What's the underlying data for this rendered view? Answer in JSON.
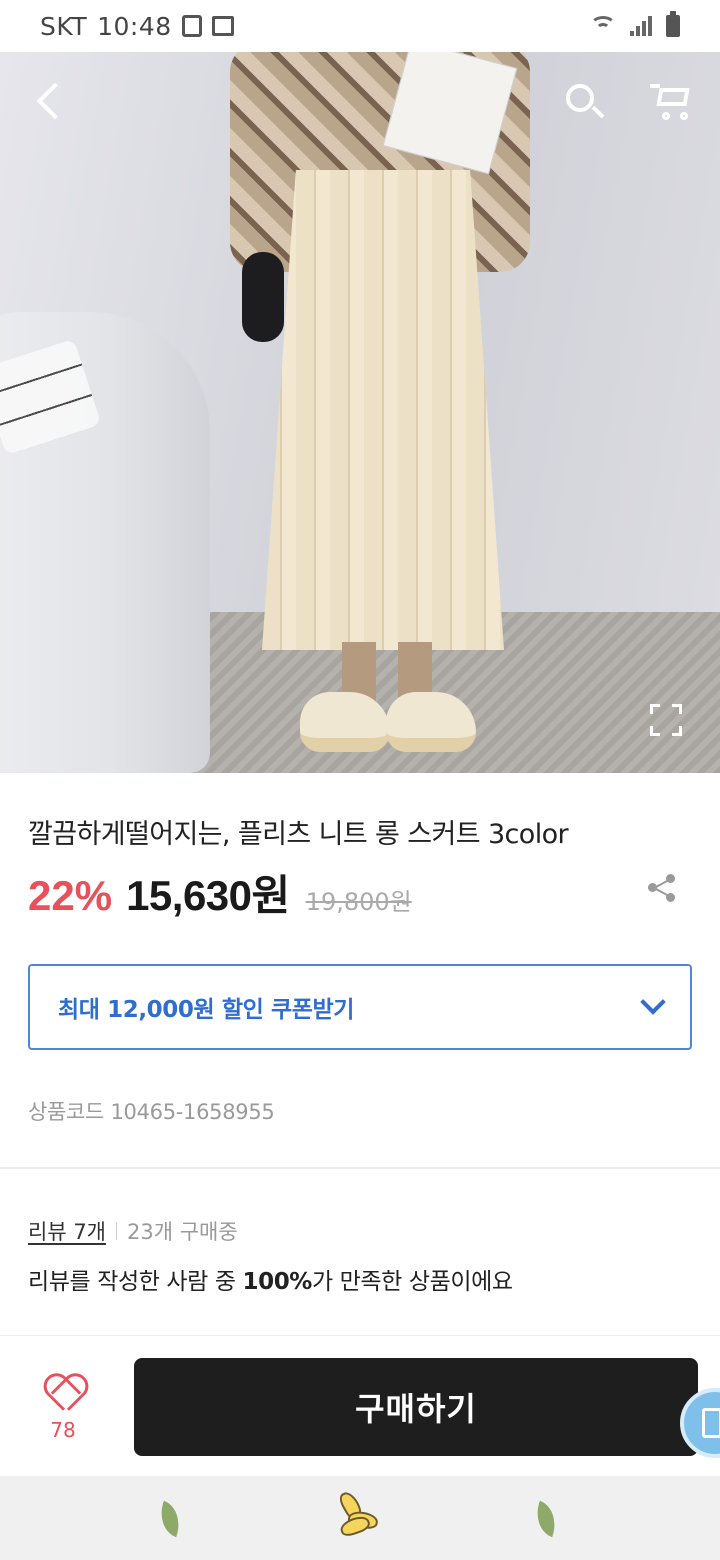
{
  "status_bar": {
    "carrier": "SKT",
    "time": "10:48"
  },
  "top_nav": {
    "back_icon": "chevron-left-icon",
    "search_icon": "search-icon",
    "cart_icon": "cart-icon"
  },
  "product": {
    "title": "깔끔하게떨어지는, 플리츠 니트 롱 스커트 3color",
    "discount": "22%",
    "price": "15,630원",
    "original_price": "19,800원",
    "coupon_label": "최대 12,000원 할인 쿠폰받기",
    "code": "상품코드 10465-1658955"
  },
  "reviews": {
    "review_link": "리뷰 7개",
    "purchase_count": "23개 구매중",
    "satisfaction_prefix": "리뷰를 작성한 사람 중 ",
    "satisfaction_percent": "100%",
    "satisfaction_suffix": "가 만족한 상품이에요"
  },
  "action_bar": {
    "like_count": "78",
    "buy_label": "구매하기"
  },
  "colors": {
    "discount": "#e8505b",
    "coupon_accent": "#2f6dd0",
    "buy_button": "#1e1e1e"
  }
}
